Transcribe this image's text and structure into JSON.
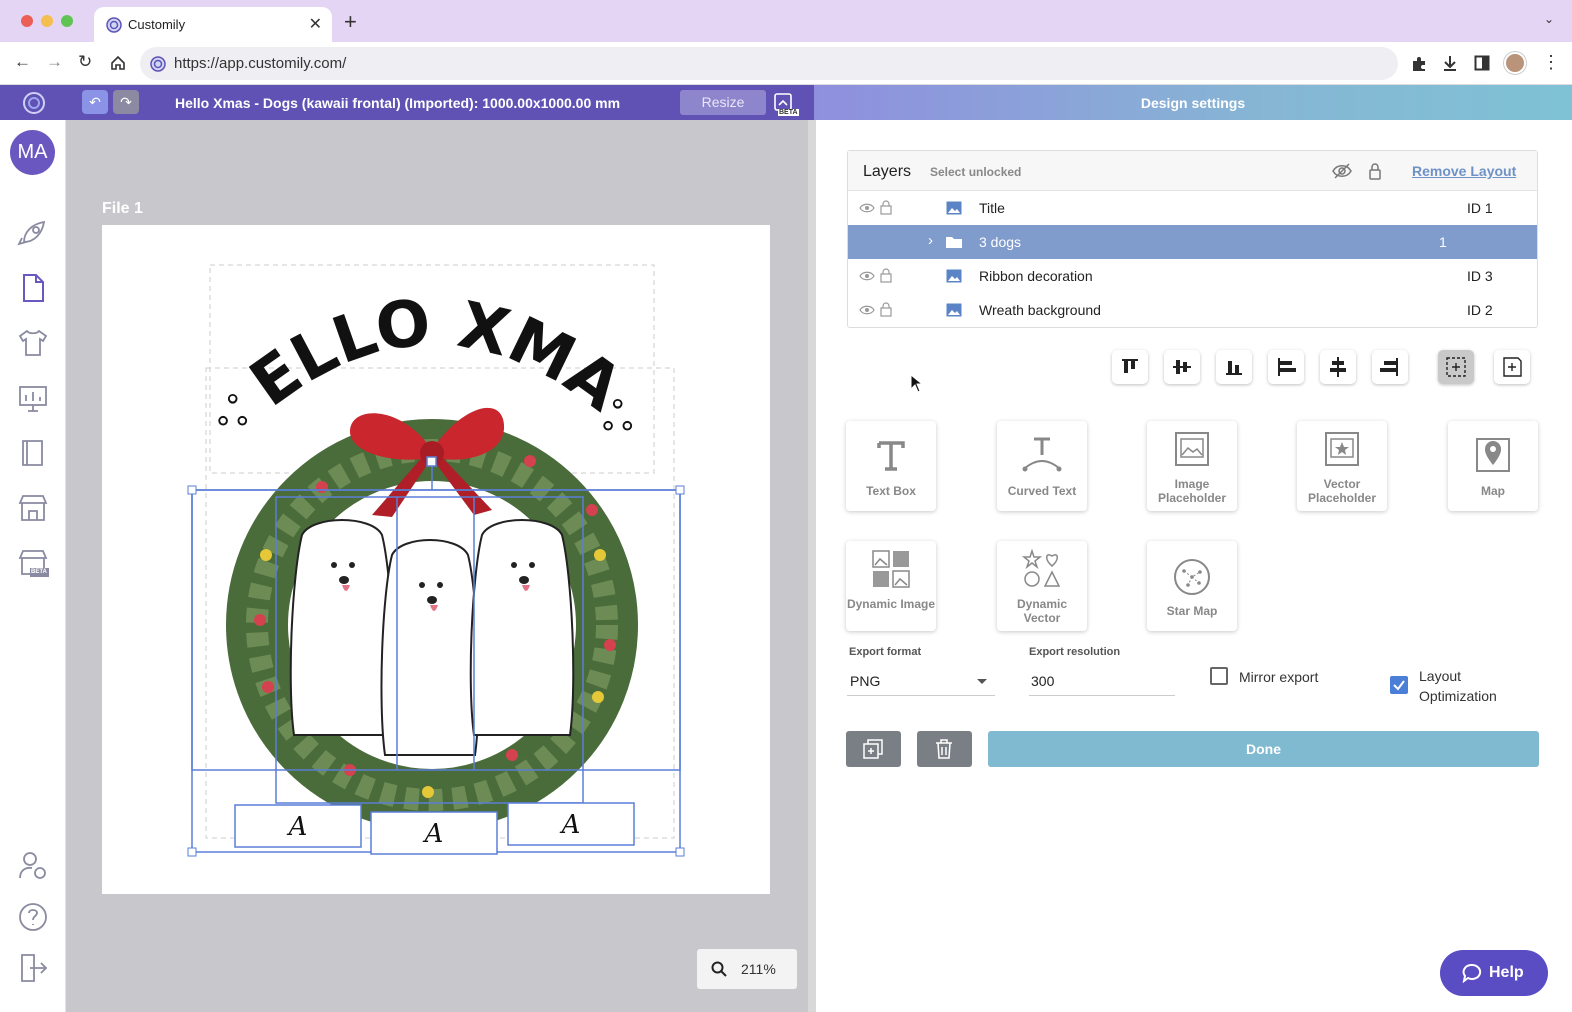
{
  "browser": {
    "tab_title": "Customily",
    "url": "https://app.customily.com/"
  },
  "header": {
    "doc_title": "Hello Xmas - Dogs (kawaii frontal) (Imported): 1000.00x1000.00 mm",
    "resize_label": "Resize",
    "beta_badge": "BETA",
    "design_settings": "Design settings"
  },
  "sidebar": {
    "avatar": "MA",
    "beta_badge": "BETA"
  },
  "canvas": {
    "file_label": "File 1",
    "artwork_title": "HELLO XMAS",
    "name_slots": [
      "A",
      "A",
      "A"
    ],
    "zoom": "211%"
  },
  "layers": {
    "title": "Layers",
    "select_unlocked": "Select unlocked",
    "remove_layout": "Remove Layout",
    "rows": [
      {
        "name": "Title",
        "id": "ID 1",
        "type": "image",
        "selected": false
      },
      {
        "name": "3 dogs",
        "id": "1",
        "type": "folder",
        "selected": true
      },
      {
        "name": "Ribbon decoration",
        "id": "ID 3",
        "type": "image",
        "selected": false
      },
      {
        "name": "Wreath background",
        "id": "ID 2",
        "type": "image",
        "selected": false
      }
    ]
  },
  "tools": [
    {
      "label": "Text Box",
      "icon": "text-t-icon"
    },
    {
      "label": "Curved Text",
      "icon": "curved-text-icon"
    },
    {
      "label": "Image Placeholder",
      "icon": "image-placeholder-icon"
    },
    {
      "label": "Vector Placeholder",
      "icon": "vector-placeholder-icon"
    },
    {
      "label": "Map",
      "icon": "map-pin-icon"
    },
    {
      "label": "Dynamic Image",
      "icon": "dynamic-image-icon"
    },
    {
      "label": "Dynamic Vector",
      "icon": "dynamic-vector-icon"
    },
    {
      "label": "Star Map",
      "icon": "star-map-icon"
    }
  ],
  "export": {
    "format_label": "Export format",
    "format_value": "PNG",
    "resolution_label": "Export resolution",
    "resolution_value": "300",
    "mirror_label": "Mirror export",
    "mirror_checked": false,
    "layout_opt_label": "Layout Optimization",
    "layout_opt_checked": true
  },
  "actions": {
    "done_label": "Done",
    "help_label": "Help"
  },
  "colors": {
    "app_header": "#5f52b4",
    "selected_row": "#7f9ccc",
    "done_button": "#7fbad0",
    "help_button": "#5a4cc3"
  }
}
